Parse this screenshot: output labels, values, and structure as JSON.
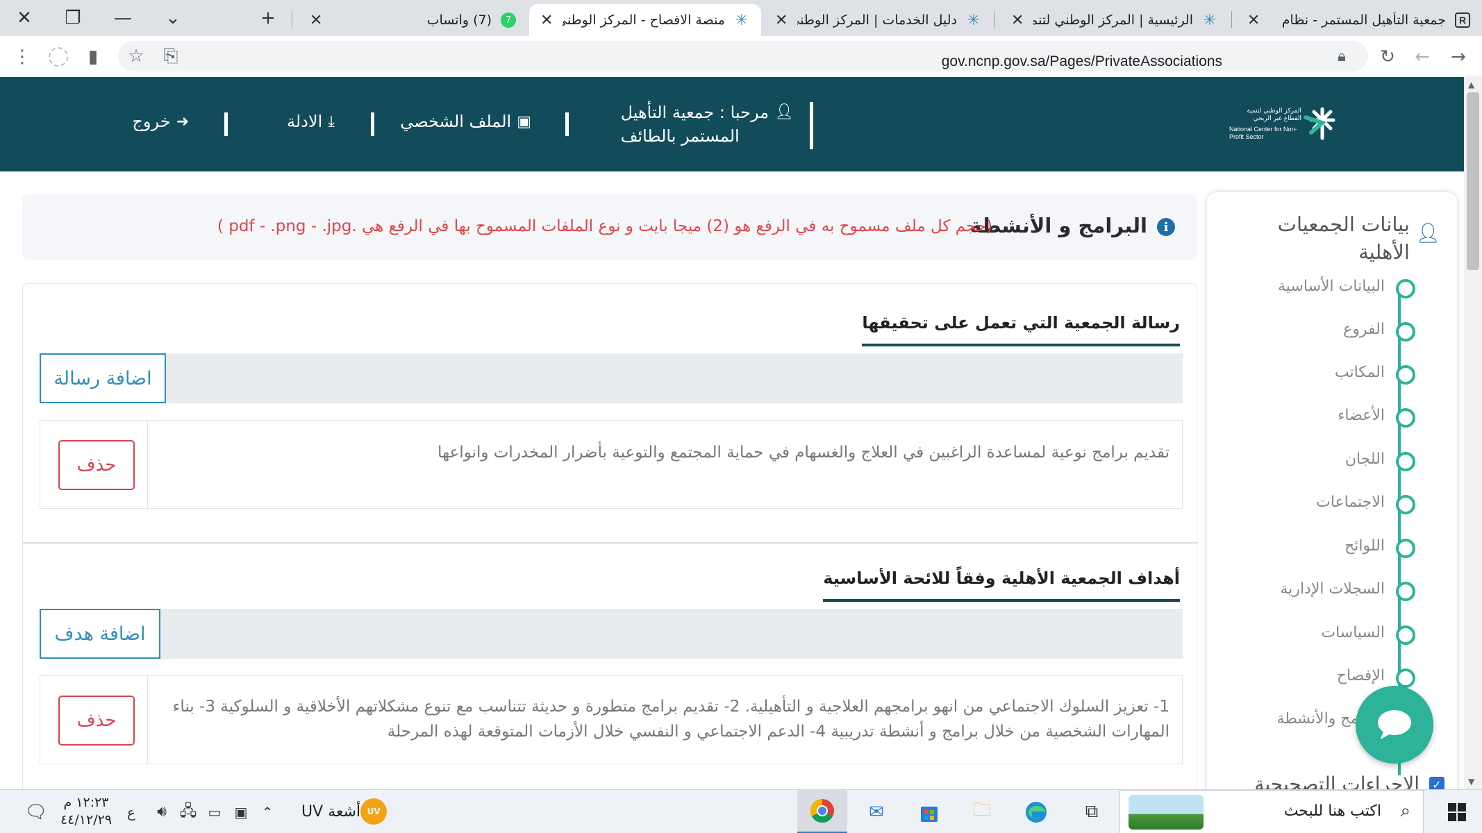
{
  "browser": {
    "tabs": [
      {
        "title": "جمعية التأهيل المستمر - نظام",
        "favicon": "r-logo-icon",
        "active": false
      },
      {
        "title": "الرئيسية | المركز الوطني لتنمية",
        "favicon": "ncnp-logo-icon",
        "active": false
      },
      {
        "title": "دليل الخدمات | المركز الوطني ل",
        "favicon": "ncnp-logo-icon",
        "active": false
      },
      {
        "title": "منصة الافصاح - المركز الوطني ل",
        "favicon": "ncnp-logo-icon",
        "active": true
      },
      {
        "title": "(7) واتساب",
        "favicon": "whatsapp-icon",
        "badge": "7",
        "active": false
      }
    ],
    "url": "gov.ncnp.gov.sa/Pages/PrivateAssociations"
  },
  "header": {
    "logo_text_ar": "المركز الوطني لتنمية القطاع غير الربحي",
    "logo_text_en": "National Center for Non-Profit Sector",
    "welcome_line1": "مرحبا : جمعية التأهيل",
    "welcome_line2": "المستمر بالطائف",
    "profile_label": "الملف الشخصي",
    "guides_label": "الادلة",
    "logout_label": "خروج"
  },
  "sidebar": {
    "title": "بيانات الجمعيات الأهلية",
    "steps": [
      {
        "label": "البيانات الأساسية"
      },
      {
        "label": "الفروع"
      },
      {
        "label": "المكاتب"
      },
      {
        "label": "الأعضاء"
      },
      {
        "label": "اللجان"
      },
      {
        "label": "الاجتماعات"
      },
      {
        "label": "اللوائح"
      },
      {
        "label": "السجلات الإدارية"
      },
      {
        "label": "السياسات"
      },
      {
        "label": "الإفصاح"
      },
      {
        "label": "البرامج والأنشطة"
      }
    ],
    "checked_section": "الإجراءات التصحيحية"
  },
  "main": {
    "info_title": "البرامج و الأنشطة",
    "info_note": "(حجم كل ملف مسموح به في الرفع هو (2) ميجا بايت و نوع الملفات المسموح بها في الرفع هي .pdf - .png - .jpg )",
    "sections": [
      {
        "title": "رسالة الجمعية التي تعمل على تحقيقها",
        "add_label": "اضافة رسالة",
        "items": [
          {
            "text": "تقديم برامج نوعية لمساعدة الراغبين في العلاج والغسهام في حماية المجتمع والتوعية بأضرار المخدرات وانواعها",
            "delete_label": "حذف"
          }
        ]
      },
      {
        "title": "أهداف الجمعية الأهلية وفقاً للائحة الأساسية",
        "add_label": "اضافة هدف",
        "items": [
          {
            "text": "1- تعزيز السلوك الاجتماعي من انهو برامجهم العلاجية و التأهيلية. 2- تقديم برامج متطورة و حديثة تتناسب مع تنوع مشكلاتهم الأخلاقية و السلوكية 3- بناء المهارات الشخصية من خلال برامج و أنشطة تدريبية 4- الدعم الاجتماعي و النفسي خلال الأزمات المتوقعة لهذه المرحلة",
            "delete_label": "حذف"
          }
        ]
      }
    ]
  },
  "taskbar": {
    "search_placeholder": "اكتب هنا للبحث",
    "weather_label": "أشعة UV",
    "weather_badge": "UV",
    "lang_indicator": "ع",
    "time": "١٢:٢٣ م",
    "date": "٤٤/١٢/٢٩"
  },
  "colors": {
    "header_bg": "#124b5a",
    "accent_teal": "#2db39a",
    "button_blue": "#2f8fb8",
    "delete_red": "#d9434b",
    "note_red": "#e0454b"
  }
}
